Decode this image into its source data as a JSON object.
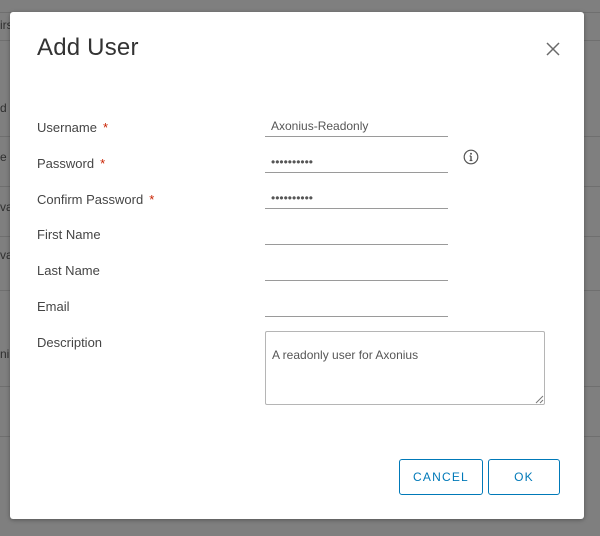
{
  "dialog": {
    "title": "Add User",
    "close_icon": "close-icon"
  },
  "form": {
    "required_marker": "*",
    "username": {
      "label": "Username",
      "value": "Axonius-Readonly",
      "required": true
    },
    "password": {
      "label": "Password",
      "value": "••••••••••",
      "required": true,
      "info_icon": "info-icon"
    },
    "confirm_password": {
      "label": "Confirm Password",
      "value": "••••••••••",
      "required": true
    },
    "first_name": {
      "label": "First Name",
      "value": ""
    },
    "last_name": {
      "label": "Last Name",
      "value": ""
    },
    "email": {
      "label": "Email",
      "value": ""
    },
    "description": {
      "label": "Description",
      "value": "A readonly user for Axonius"
    }
  },
  "buttons": {
    "cancel": "CANCEL",
    "ok": "OK"
  },
  "background": {
    "fragments": [
      "irs",
      "d",
      "e",
      "va",
      "va",
      "ni"
    ]
  },
  "colors": {
    "accent": "#0079b8",
    "required": "#c92100",
    "overlay": "#7f7f7f"
  }
}
